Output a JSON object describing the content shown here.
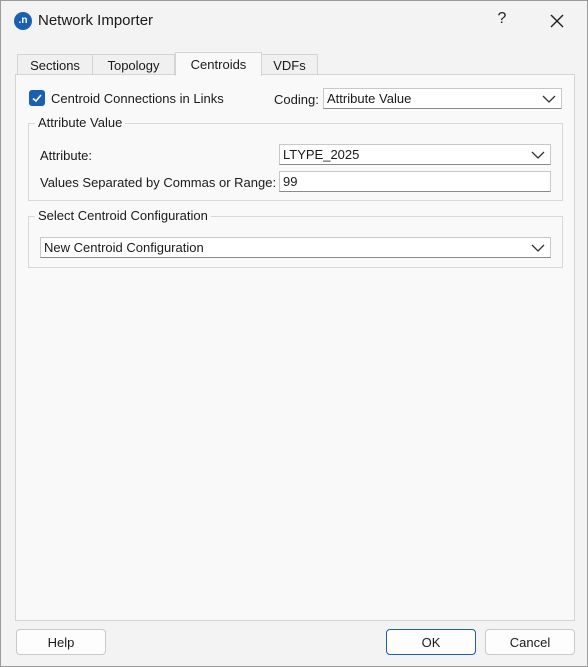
{
  "window": {
    "title": "Network Importer",
    "app_icon_text": ".n",
    "help_glyph": "?"
  },
  "tabs": [
    {
      "label": "Sections",
      "active": false
    },
    {
      "label": "Topology",
      "active": false
    },
    {
      "label": "Centroids",
      "active": true
    },
    {
      "label": "VDFs",
      "active": false
    }
  ],
  "centroids": {
    "connections_checkbox": {
      "label": "Centroid Connections in Links",
      "checked": true
    },
    "coding": {
      "label": "Coding:",
      "value": "Attribute Value"
    },
    "attribute_group": {
      "title": "Attribute Value",
      "attribute_label": "Attribute:",
      "attribute_value": "LTYPE_2025",
      "values_label": "Values Separated by Commas or Range:",
      "values_value": "99"
    },
    "config_group": {
      "title": "Select Centroid Configuration",
      "value": "New Centroid Configuration"
    }
  },
  "buttons": {
    "help": "Help",
    "ok": "OK",
    "cancel": "Cancel"
  },
  "colors": {
    "accent": "#1a5fb4",
    "window_bg": "#f3f3f3",
    "panel_bg": "#f9f9f9"
  }
}
